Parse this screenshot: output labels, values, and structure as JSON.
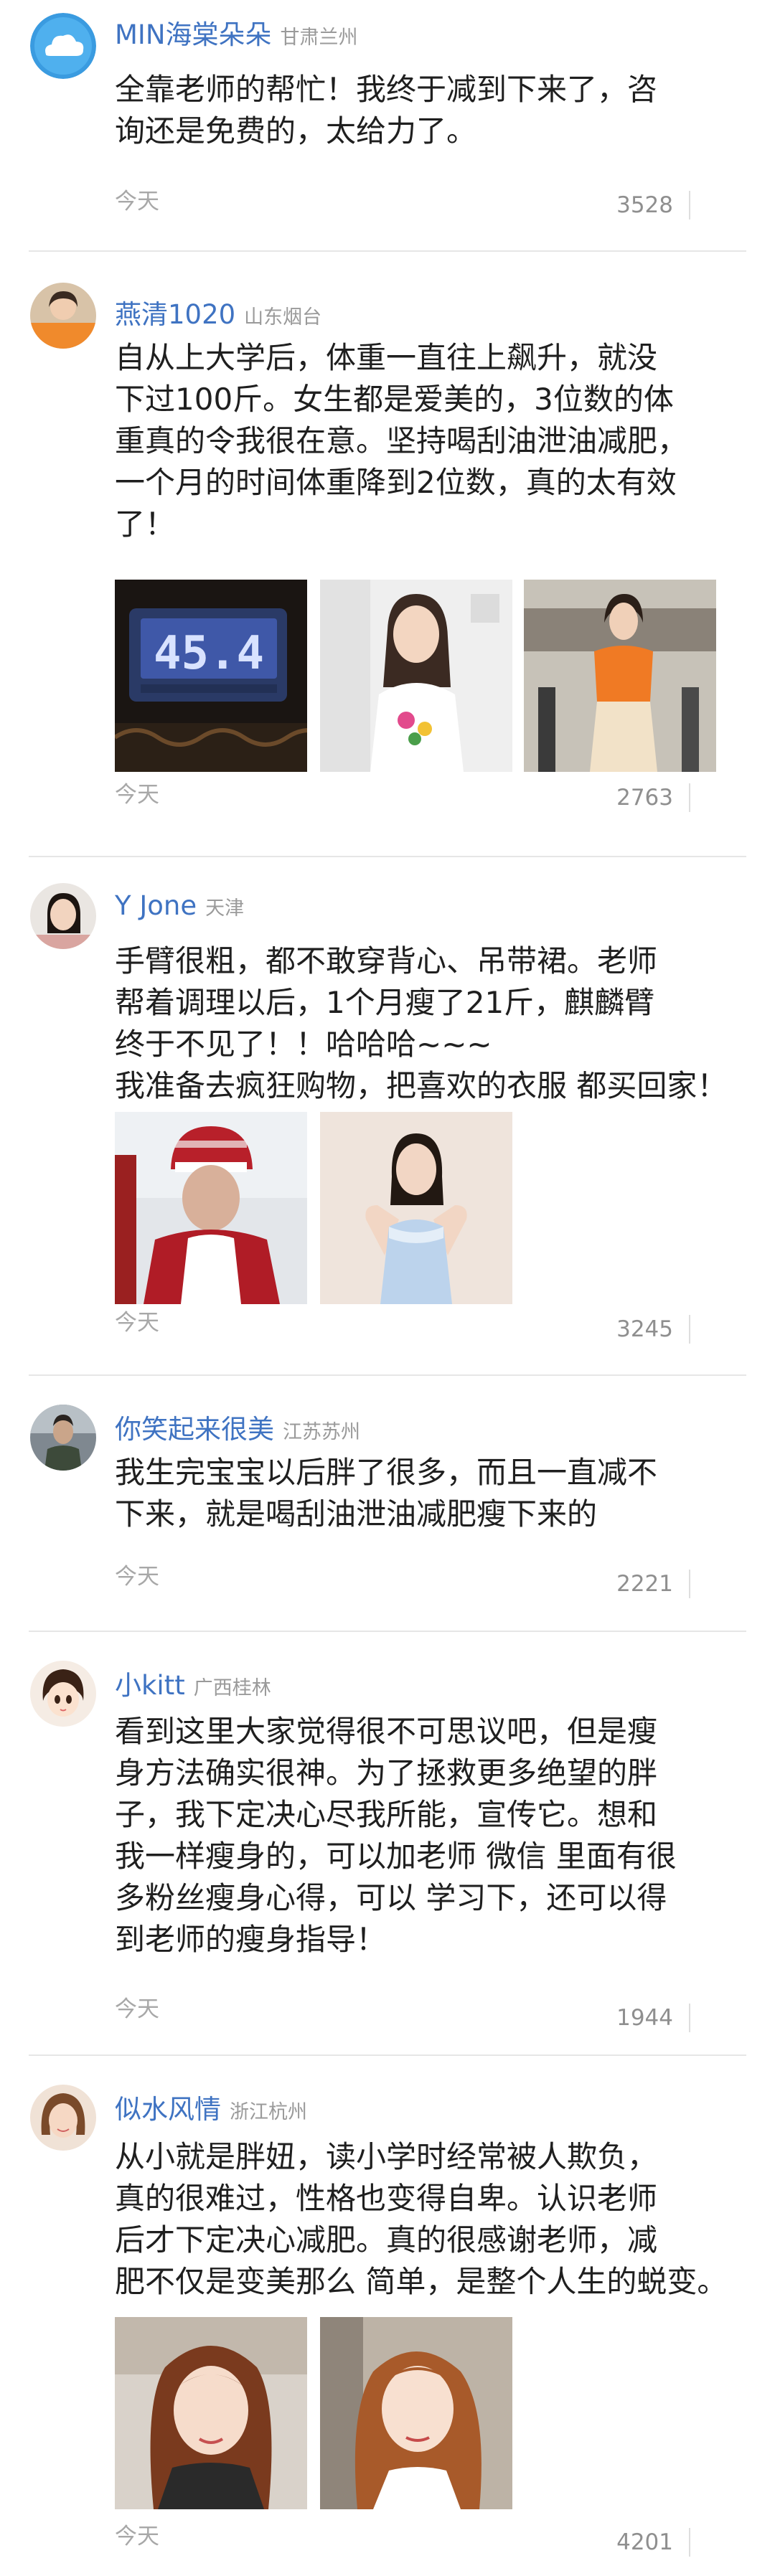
{
  "comments": [
    {
      "username": "MIN海棠朵朵",
      "location": "甘肃兰州",
      "avatar_icon": "cloud-icon",
      "lines": [
        "全靠老师的帮忙！我终于减到下来了，咨",
        "询还是免费的，太给力了。"
      ],
      "time": "今天",
      "likes": "3528"
    },
    {
      "username": "燕清1020",
      "location": "山东烟台",
      "lines": [
        "自从上大学后，体重一直往上飙升，就没",
        "下过100斤。女生都是爱美的，3位数的体",
        "重真的令我很在意。坚持喝刮油泄油减肥，",
        "一个月的时间体重降到2位数，真的太有效",
        "了！"
      ],
      "scale_reading": "45.4",
      "time": "今天",
      "likes": "2763"
    },
    {
      "username": "Y Jone",
      "location": "天津",
      "lines": [
        "手臂很粗，都不敢穿背心、吊带裙。老师",
        "帮着调理以后，1个月瘦了21斤，麒麟臂",
        "终于不见了！！哈哈哈~~~",
        "我准备去疯狂购物，把喜欢的衣服 都买回家！"
      ],
      "time": "今天",
      "likes": "3245"
    },
    {
      "username": "你笑起来很美",
      "location": "江苏苏州",
      "lines": [
        "我生完宝宝以后胖了很多，而且一直减不",
        "下来，就是喝刮油泄油减肥瘦下来的"
      ],
      "time": "今天",
      "likes": "2221"
    },
    {
      "username": "小kitt",
      "location": "广西桂林",
      "lines": [
        "看到这里大家觉得很不可思议吧，但是瘦",
        "身方法确实很神。为了拯救更多绝望的胖",
        "子，我下定决心尽我所能，宣传它。想和",
        "我一样瘦身的，可以加老师 微信 里面有很",
        "多粉丝瘦身心得，可以 学习下，还可以得",
        "到老师的瘦身指导！"
      ],
      "time": "今天",
      "likes": "1944"
    },
    {
      "username": "似水风情",
      "location": "浙江杭州",
      "lines": [
        "从小就是胖妞，读小学时经常被人欺负，",
        "真的很难过，性格也变得自卑。认识老师",
        "后才下定决心减肥。真的很感谢老师，减",
        "肥不仅是变美那么 简单，是整个人生的蜕变。"
      ],
      "time": "今天",
      "likes": "4201"
    }
  ],
  "colors": {
    "username": "#3f73c2",
    "location": "#9a9a9a",
    "body_text": "#1f1f1f",
    "meta": "#a8a8a8",
    "divider": "#e6e6e6"
  }
}
